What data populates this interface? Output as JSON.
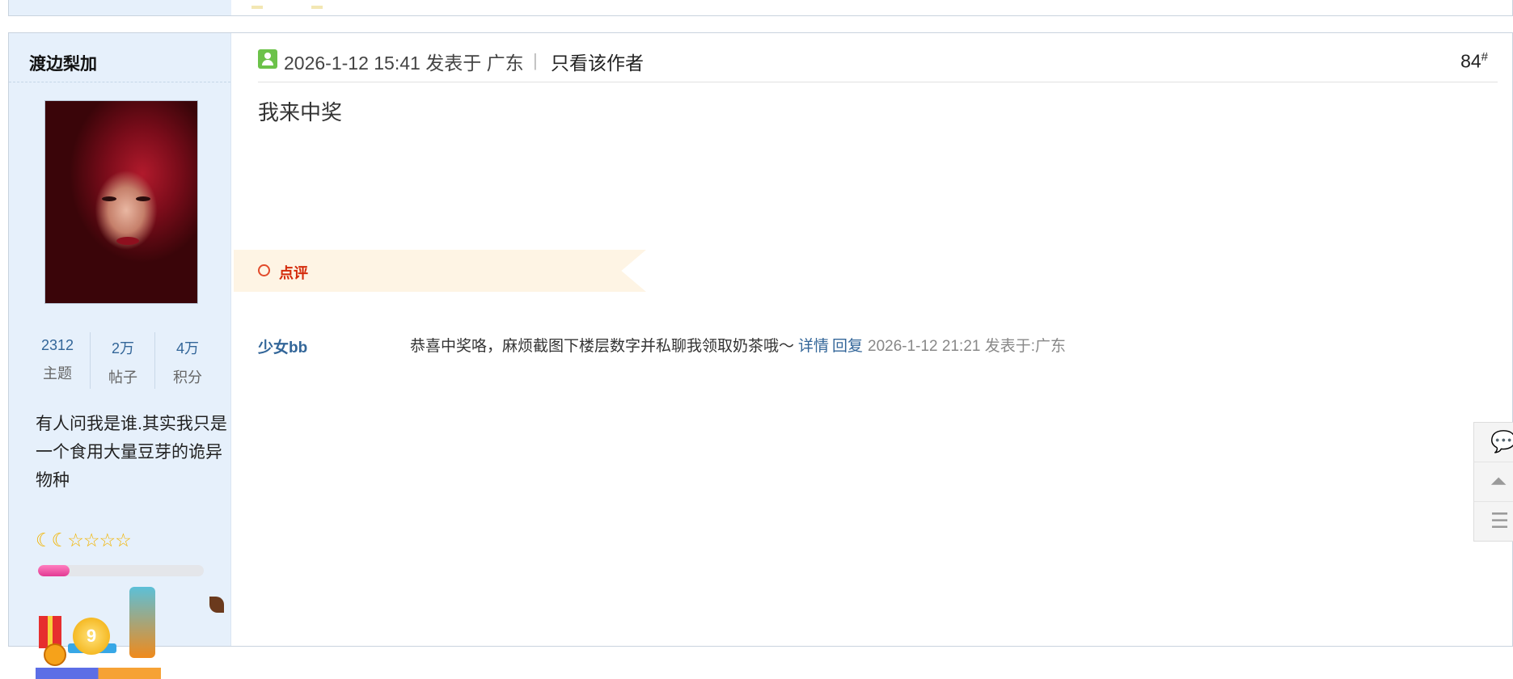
{
  "post": {
    "author": {
      "name": "渡边梨加",
      "stats": [
        {
          "value": "2312",
          "label": "主题"
        },
        {
          "value": "2万",
          "label": "帖子"
        },
        {
          "value": "4万",
          "label": "积分"
        }
      ],
      "bio": "有人问我是谁.其实我只是一个食用大量豆芽的诡异物种",
      "level_icons": [
        "moon-icon",
        "moon-icon",
        "star-icon",
        "star-icon",
        "star-icon",
        "star-icon"
      ],
      "level_progress": 0.19,
      "medal_number": "9"
    },
    "time": "2026-1-12 15:41 发表于 广东",
    "separator": "|",
    "only_author_label": "只看该作者",
    "floor": "84",
    "floor_mark": "#",
    "message": "我来中奖",
    "comments_section": {
      "title": "点评",
      "items": [
        {
          "user": "少女bb",
          "text": "恭喜中奖咯，麻烦截图下楼层数字并私聊我领取奶茶哦～",
          "detail_label": "详情",
          "reply_label": "回复",
          "time": "2026-1-12 21:21 发表于:广东"
        }
      ]
    }
  },
  "float_toolbar": {
    "icons": [
      "comment-icon",
      "back-to-top-icon",
      "list-icon"
    ]
  },
  "colors": {
    "sidebar_bg": "#e6f0fb",
    "link": "#336699",
    "comment_title": "#d42a0a",
    "progress_fill": "#e23a93"
  }
}
